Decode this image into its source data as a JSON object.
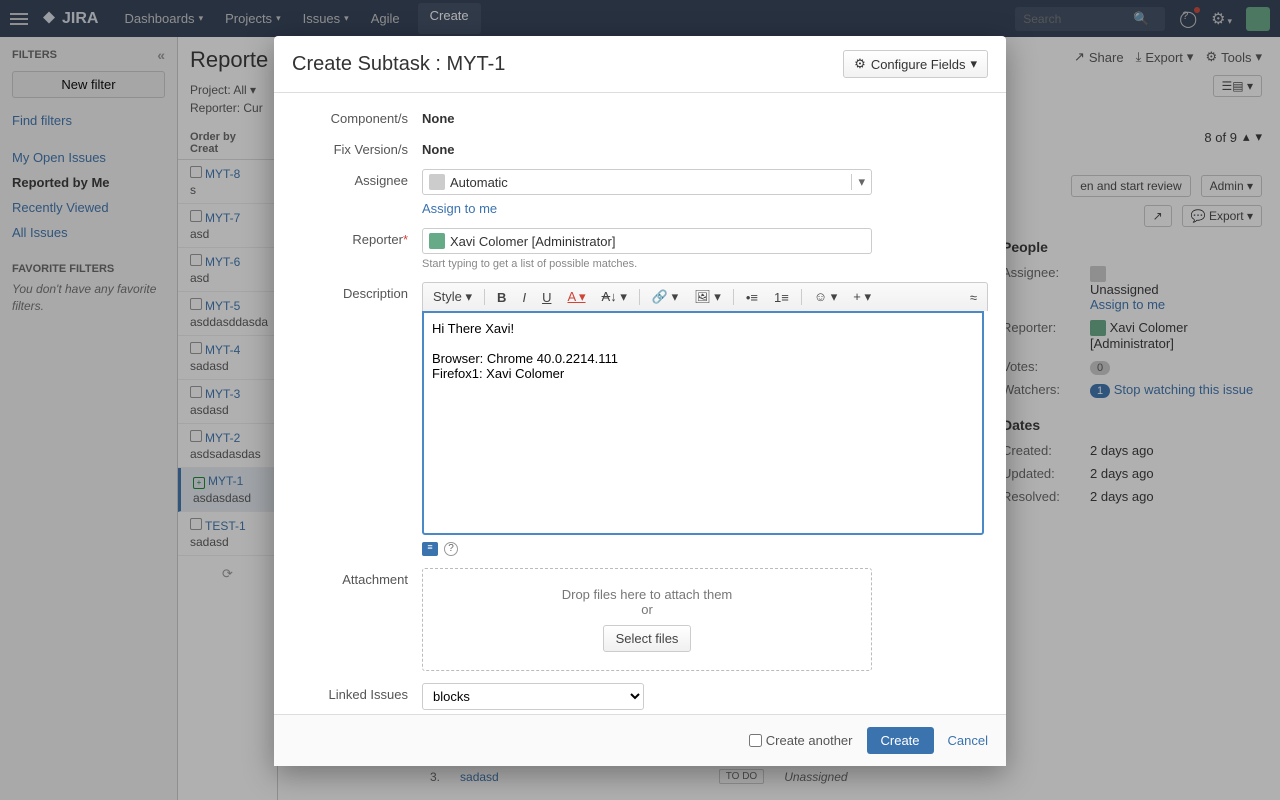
{
  "nav": {
    "product": "JIRA",
    "links": [
      "Dashboards",
      "Projects",
      "Issues",
      "Agile"
    ],
    "create": "Create",
    "search_placeholder": "Search"
  },
  "sidebar": {
    "filters_hdr": "FILTERS",
    "new_filter": "New filter",
    "find_filters": "Find filters",
    "links": [
      "My Open Issues",
      "Reported by Me",
      "Recently Viewed",
      "All Issues"
    ],
    "fav_hdr": "FAVORITE FILTERS",
    "fav_note": "You don't have any favorite filters."
  },
  "list": {
    "title_prefix": "Reporte",
    "project": "Project: All",
    "reporter": "Reporter: Cur",
    "order": "Order by Creat",
    "items": [
      {
        "key": "MYT-8",
        "sum": "s"
      },
      {
        "key": "MYT-7",
        "sum": "asd"
      },
      {
        "key": "MYT-6",
        "sum": "asd"
      },
      {
        "key": "MYT-5",
        "sum": "asddasddasda"
      },
      {
        "key": "MYT-4",
        "sum": "sadasd"
      },
      {
        "key": "MYT-3",
        "sum": "asdasd"
      },
      {
        "key": "MYT-2",
        "sum": "asdsadasdas"
      },
      {
        "key": "MYT-1",
        "sum": "asdasdasd"
      },
      {
        "key": "TEST-1",
        "sum": "sadasd"
      }
    ]
  },
  "detail": {
    "actions": {
      "share": "Share",
      "export": "Export",
      "tools": "Tools"
    },
    "pager": "8 of 9",
    "open_review": "en and start review",
    "admin": "Admin",
    "export_btn": "Export",
    "people_hdr": "People",
    "assignee_lbl": "Assignee:",
    "assignee_val": "Unassigned",
    "assign_me": "Assign to me",
    "reporter_lbl": "Reporter:",
    "reporter_val": "Xavi Colomer [Administrator]",
    "votes_lbl": "Votes:",
    "votes_val": "0",
    "watchers_lbl": "Watchers:",
    "watchers_val": "1",
    "stop_watch": "Stop watching this issue",
    "dates_hdr": "Dates",
    "created_lbl": "Created:",
    "updated_lbl": "Updated:",
    "resolved_lbl": "Resolved:",
    "two_days": "2 days ago",
    "tbl_row3": "sadasd",
    "status_todo": "TO DO",
    "status_unassigned": "Unassigned"
  },
  "modal": {
    "title": "Create Subtask : MYT-1",
    "configure": "Configure Fields",
    "components_lbl": "Component/s",
    "components_val": "None",
    "fixv_lbl": "Fix Version/s",
    "fixv_val": "None",
    "assignee_lbl": "Assignee",
    "assignee_val": "Automatic",
    "assign_me": "Assign to me",
    "reporter_lbl": "Reporter",
    "reporter_val": "Xavi Colomer [Administrator]",
    "reporter_hint": "Start typing to get a list of possible matches.",
    "desc_lbl": "Description",
    "style": "Style",
    "desc_text": "Hi There Xavi!\n\nBrowser: Chrome 40.0.2214.111\nFirefox1: Xavi Colomer",
    "attach_lbl": "Attachment",
    "drop_text": "Drop files here to attach them",
    "or": "or",
    "select_files": "Select files",
    "linked_lbl": "Linked Issues",
    "linked_val": "blocks",
    "create_another": "Create another",
    "create": "Create",
    "cancel": "Cancel"
  }
}
